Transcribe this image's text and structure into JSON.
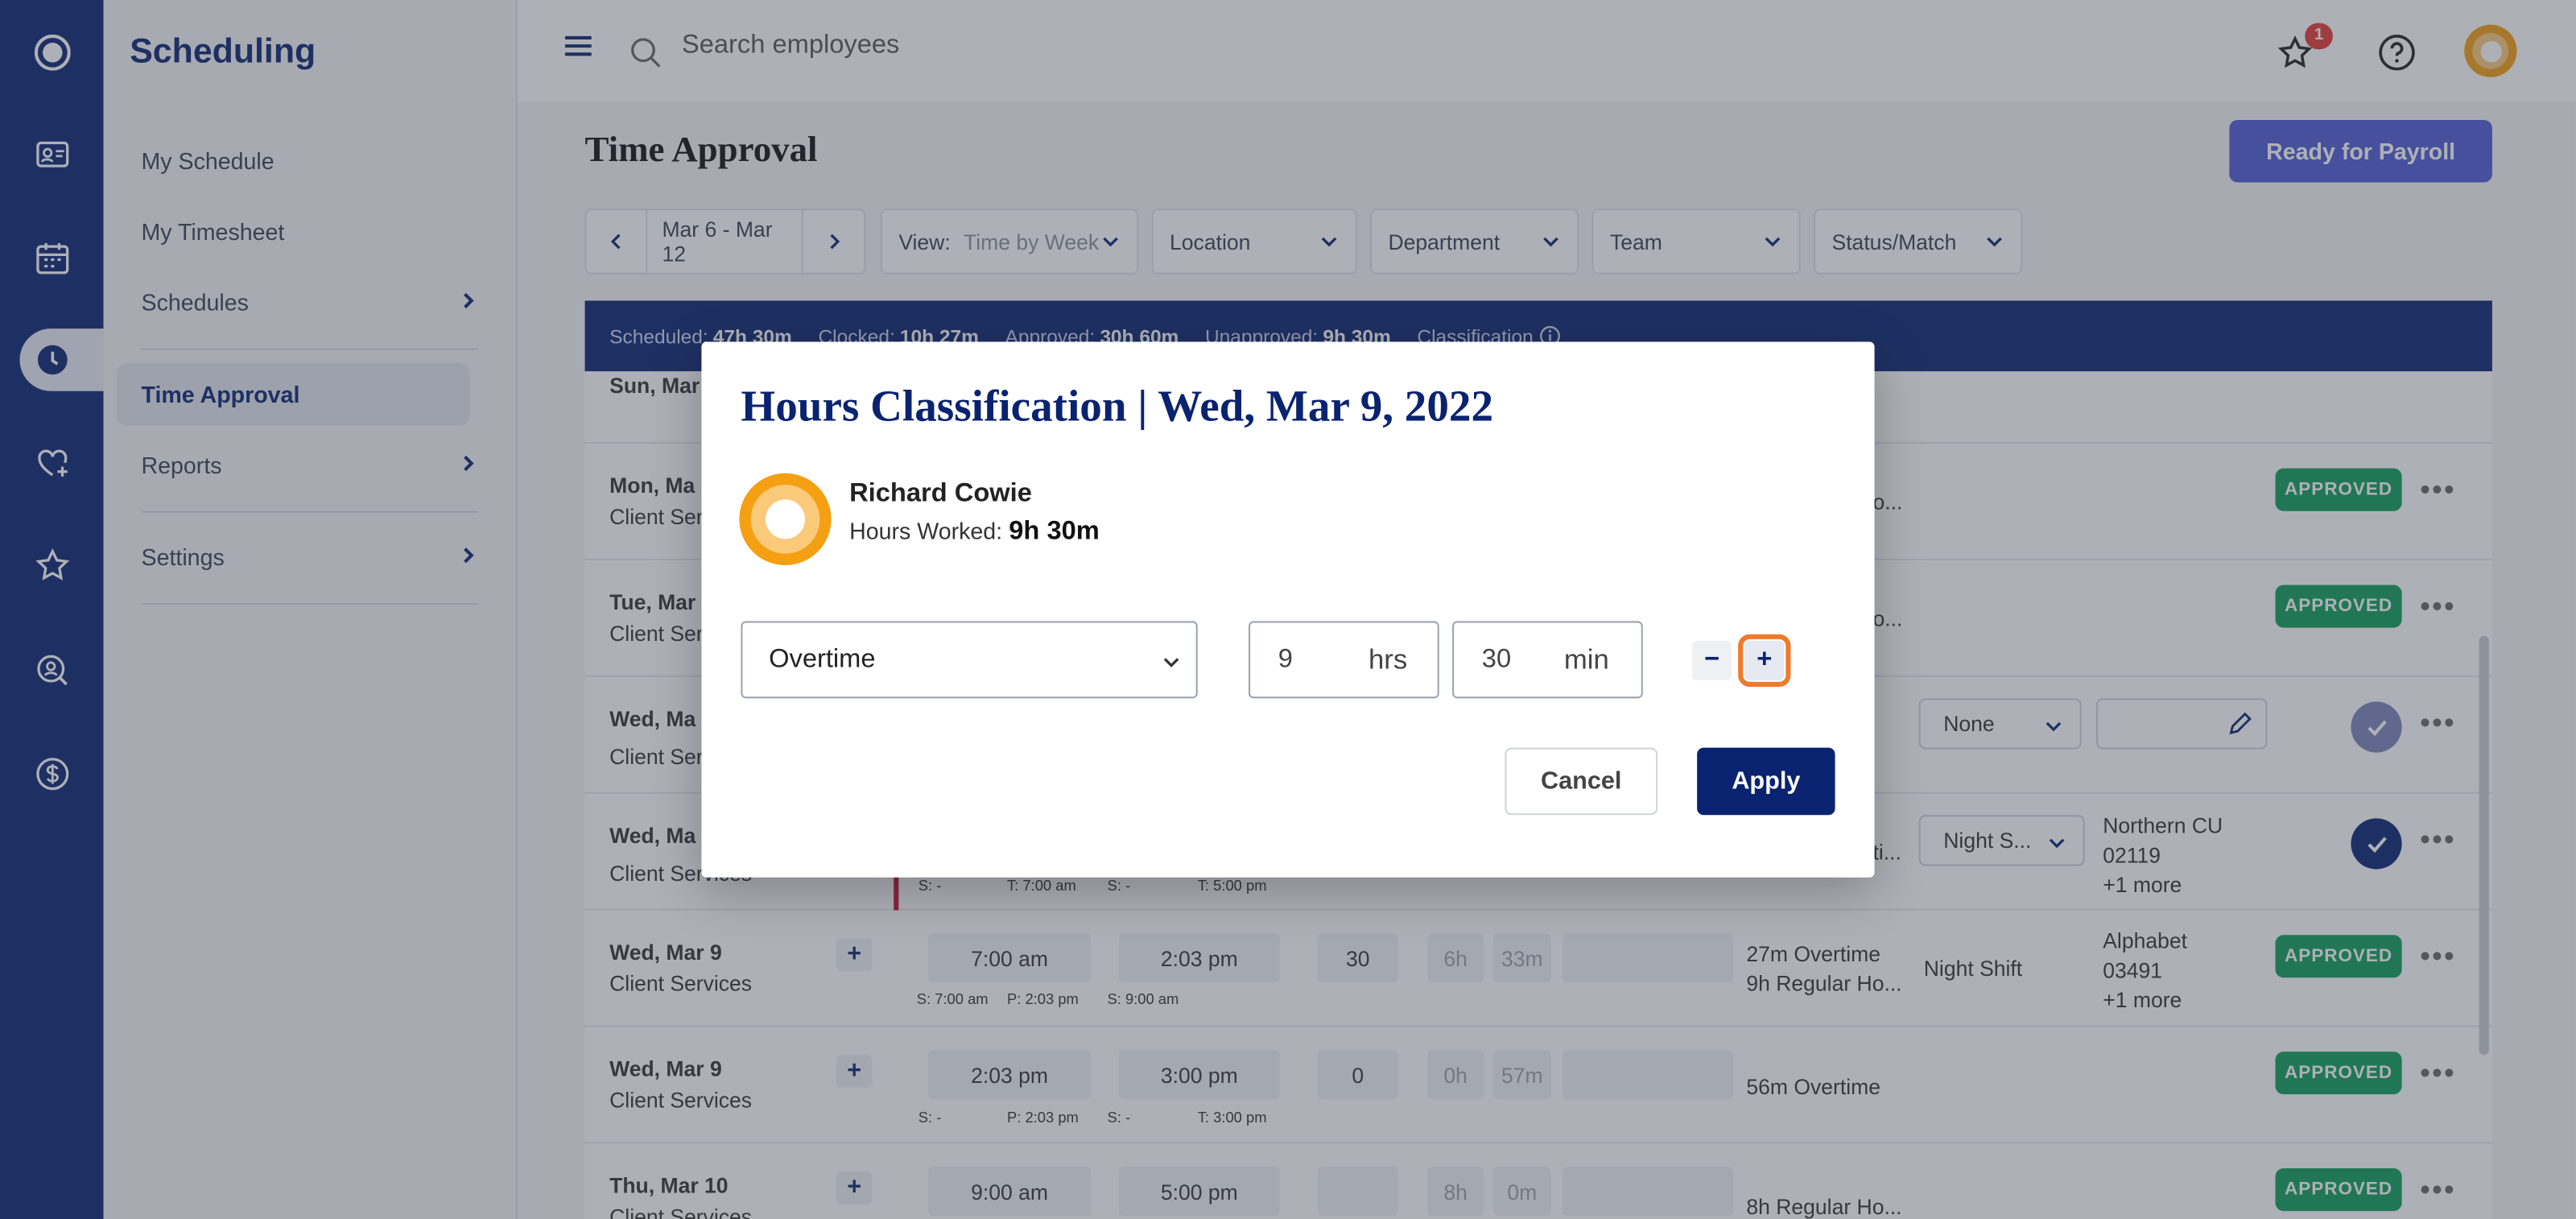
{
  "sidebar": {
    "brand": "Scheduling",
    "items": [
      {
        "label": "My Schedule"
      },
      {
        "label": "My Timesheet"
      },
      {
        "label": "Schedules"
      },
      {
        "label": "Time Approval"
      },
      {
        "label": "Reports"
      },
      {
        "label": "Settings"
      }
    ]
  },
  "topbar": {
    "search_placeholder": "Search employees",
    "notification_count": "1"
  },
  "page": {
    "title": "Time Approval",
    "payroll_button": "Ready for Payroll"
  },
  "filters": {
    "date_range": "Mar 6 - Mar 12",
    "view_label": "View:",
    "view_value": "Time by Week",
    "location": "Location",
    "department": "Department",
    "team": "Team",
    "status": "Status/Match"
  },
  "summary": {
    "scheduled_label": "Scheduled:",
    "scheduled": "47h 30m",
    "clocked_label": "Clocked:",
    "clocked": "10h 27m",
    "approved_label": "Approved:",
    "approved": "30h 60m",
    "unapproved_label": "Unapproved:",
    "unapproved": "9h 30m",
    "classification_label": "Classification"
  },
  "rows": [
    {
      "date": "Sun, Mar",
      "dept": ""
    },
    {
      "date": "Mon, Ma",
      "dept": "Client Ser",
      "classif": "o...",
      "status": "APPROVED"
    },
    {
      "date": "Tue, Mar",
      "dept": "Client Ser",
      "classif": "o...",
      "status": "APPROVED"
    },
    {
      "date": "Wed, Ma",
      "dept": "Client Ser",
      "select": "None"
    },
    {
      "date": "Wed, Ma",
      "dept": "Client Services",
      "classif": "ti...",
      "select": "Night S...",
      "loc1": "Northern CU",
      "loc2": "02119",
      "loc3": "+1 more",
      "s1": "S: -",
      "t1": "T:  7:00 am",
      "s2": "S: -",
      "t2": "T:  5:00 pm"
    },
    {
      "date": "Wed, Mar 9",
      "dept": "Client Services",
      "in": "7:00 am",
      "out": "2:03 pm",
      "brk": "30",
      "h": "6h",
      "m": "33m",
      "classif1": "27m Overtime",
      "classif2": "9h Regular Ho...",
      "shift": "Night Shift",
      "loc1": "Alphabet",
      "loc2": "03491",
      "loc3": "+1 more",
      "status": "APPROVED",
      "s1": "S: 7:00 am",
      "p1": "P:  2:03 pm",
      "s2": "S:  9:00 am"
    },
    {
      "date": "Wed, Mar 9",
      "dept": "Client Services",
      "in": "2:03 pm",
      "out": "3:00 pm",
      "brk": "0",
      "h": "0h",
      "m": "57m",
      "classif1": "56m Overtime",
      "status": "APPROVED",
      "s1": "S: -",
      "p1": "P:  2:03 pm",
      "s2": "S: -",
      "t2": "T:  3:00 pm"
    },
    {
      "date": "Thu, Mar 10",
      "dept": "Client Services",
      "in": "9:00 am",
      "out": "5:00 pm",
      "h": "8h",
      "m": "0m",
      "classif1": "8h Regular Ho...",
      "status": "APPROVED"
    }
  ],
  "modal": {
    "title": "Hours Classification | Wed, Mar 9, 2022",
    "employee_name": "Richard Cowie",
    "hours_worked_label": "Hours Worked:",
    "hours_worked": "9h 30m",
    "classification": "Overtime",
    "hours_value": "9",
    "hours_unit": "hrs",
    "minutes_value": "30",
    "minutes_unit": "min",
    "minus": "−",
    "plus": "+",
    "cancel": "Cancel",
    "apply": "Apply"
  },
  "colors": {
    "navy": "#0a2370",
    "approved": "#0f9d58",
    "payroll": "#4f5bd5",
    "focus": "#f07a2d",
    "avatar": "#f59f12"
  }
}
